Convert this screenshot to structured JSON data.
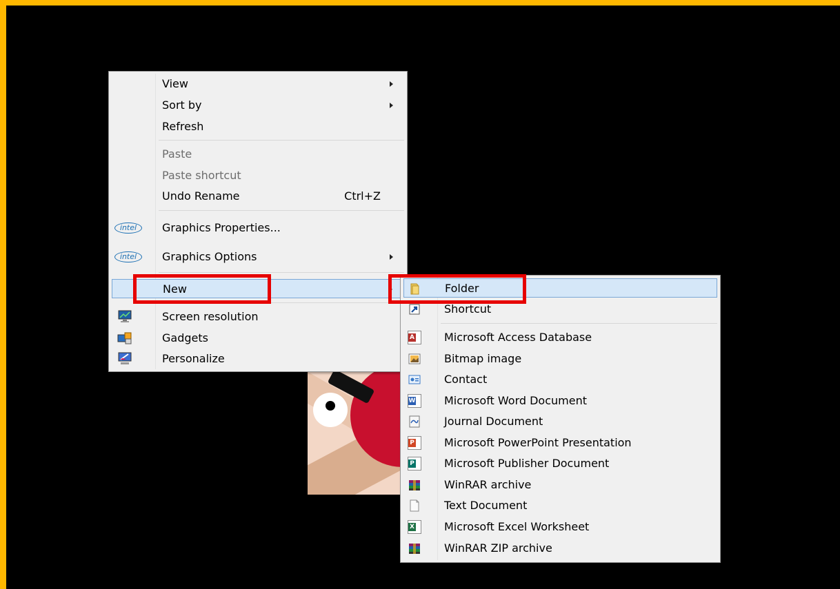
{
  "context_menu": {
    "items": {
      "view": "View",
      "sort_by": "Sort by",
      "refresh": "Refresh",
      "paste": "Paste",
      "paste_shortcut": "Paste shortcut",
      "undo_rename": "Undo Rename",
      "undo_rename_accel": "Ctrl+Z",
      "graphics_properties": "Graphics Properties...",
      "graphics_options": "Graphics Options",
      "new": "New",
      "screen_resolution": "Screen resolution",
      "gadgets": "Gadgets",
      "personalize": "Personalize"
    },
    "intel_logo_text": "intel"
  },
  "new_submenu": {
    "items": {
      "folder": "Folder",
      "shortcut": "Shortcut",
      "access": "Microsoft Access Database",
      "bitmap": "Bitmap image",
      "contact": "Contact",
      "word": "Microsoft Word Document",
      "journal": "Journal Document",
      "powerpoint": "Microsoft PowerPoint Presentation",
      "publisher": "Microsoft Publisher Document",
      "winrar": "WinRAR archive",
      "text": "Text Document",
      "excel": "Microsoft Excel Worksheet",
      "winrar_zip": "WinRAR ZIP archive"
    },
    "icon_letters": {
      "access": "A",
      "word": "W",
      "powerpoint": "P",
      "publisher": "P",
      "excel": "X"
    }
  },
  "colors": {
    "frame": "#ffb800",
    "highlight_box": "#e60000",
    "menu_hover": "#d5e7f8"
  }
}
